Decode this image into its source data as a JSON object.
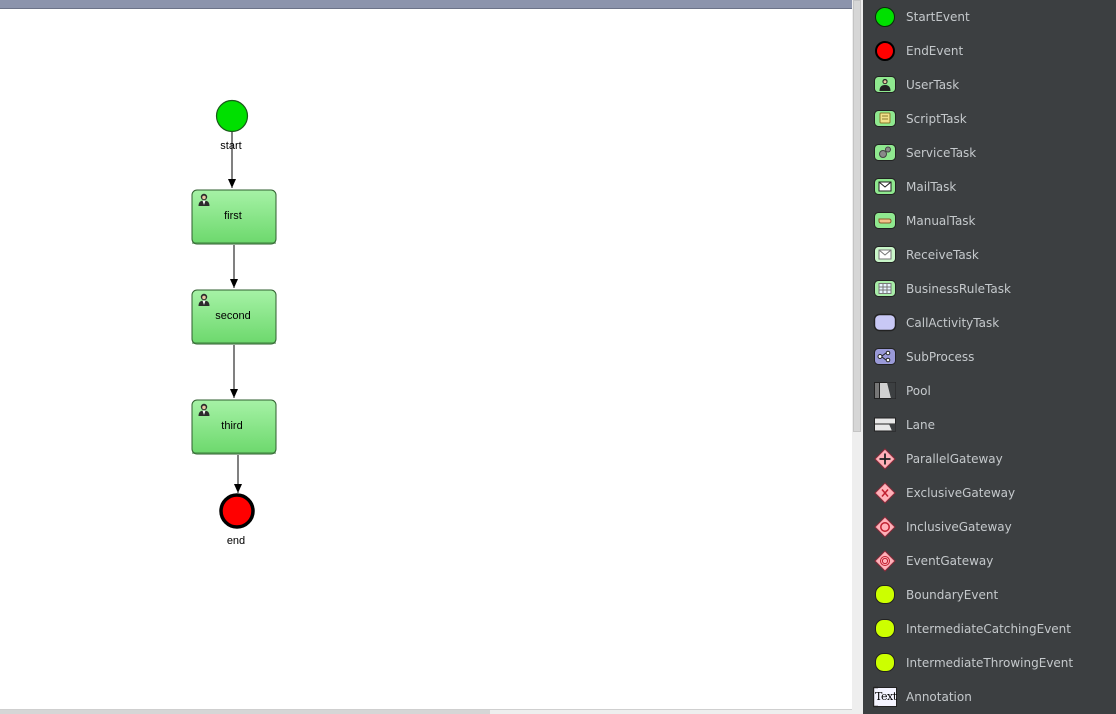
{
  "diagram": {
    "start_label": "start",
    "task1_label": "first",
    "task2_label": "second",
    "task3_label": "third",
    "end_label": "end"
  },
  "palette": {
    "items": [
      {
        "label": "StartEvent",
        "icon": "start-event-icon"
      },
      {
        "label": "EndEvent",
        "icon": "end-event-icon"
      },
      {
        "label": "UserTask",
        "icon": "user-task-icon"
      },
      {
        "label": "ScriptTask",
        "icon": "script-task-icon"
      },
      {
        "label": "ServiceTask",
        "icon": "service-task-icon"
      },
      {
        "label": "MailTask",
        "icon": "mail-task-icon"
      },
      {
        "label": "ManualTask",
        "icon": "manual-task-icon"
      },
      {
        "label": "ReceiveTask",
        "icon": "receive-task-icon"
      },
      {
        "label": "BusinessRuleTask",
        "icon": "business-rule-task-icon"
      },
      {
        "label": "CallActivityTask",
        "icon": "call-activity-task-icon"
      },
      {
        "label": "SubProcess",
        "icon": "subprocess-icon"
      },
      {
        "label": "Pool",
        "icon": "pool-icon"
      },
      {
        "label": "Lane",
        "icon": "lane-icon"
      },
      {
        "label": "ParallelGateway",
        "icon": "parallel-gateway-icon"
      },
      {
        "label": "ExclusiveGateway",
        "icon": "exclusive-gateway-icon"
      },
      {
        "label": "InclusiveGateway",
        "icon": "inclusive-gateway-icon"
      },
      {
        "label": "EventGateway",
        "icon": "event-gateway-icon"
      },
      {
        "label": "BoundaryEvent",
        "icon": "boundary-event-icon"
      },
      {
        "label": "IntermediateCatchingEvent",
        "icon": "intermediate-catching-event-icon"
      },
      {
        "label": "IntermediateThrowingEvent",
        "icon": "intermediate-throwing-event-icon"
      },
      {
        "label": "Annotation",
        "icon": "annotation-icon",
        "icon_text": "Text"
      }
    ]
  },
  "colors": {
    "task_fill": "#8fe88f",
    "start_fill": "#00e000",
    "end_fill": "#ff0000",
    "palette_bg": "#3c3f41",
    "palette_text": "#c5c9cc"
  }
}
